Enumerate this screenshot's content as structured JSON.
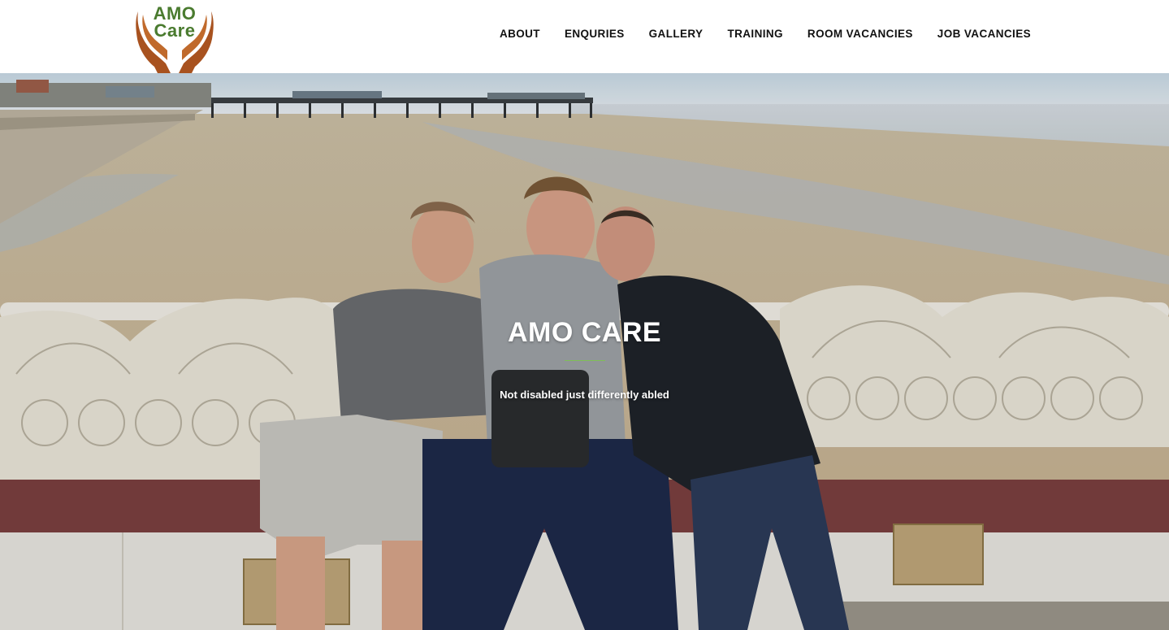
{
  "header": {
    "logo": {
      "line1": "AMO",
      "line2": "Care",
      "text_color": "#4a7b2f",
      "hands_color": "#a8521f",
      "icon": "hands-icon"
    },
    "nav": [
      {
        "label": "ABOUT"
      },
      {
        "label": "ENQURIES"
      },
      {
        "label": "GALLERY"
      },
      {
        "label": "TRAINING"
      },
      {
        "label": "ROOM VACANCIES"
      },
      {
        "label": "JOB VACANCIES"
      }
    ]
  },
  "hero": {
    "title": "AMO CARE",
    "subtitle": "Not disabled just differently abled",
    "divider_color": "#7fbf57"
  }
}
